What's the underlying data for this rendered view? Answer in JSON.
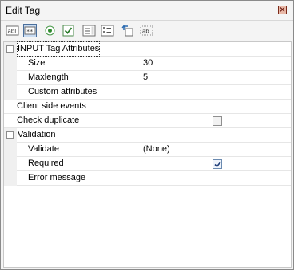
{
  "window": {
    "title": "Edit Tag",
    "close_icon": "close-icon"
  },
  "toolbar": {
    "buttons": [
      {
        "icon": "text-field-icon",
        "text": "abl",
        "active": false
      },
      {
        "icon": "password-field-icon",
        "text": "**",
        "active": true
      },
      {
        "icon": "radio-button-icon",
        "active": false
      },
      {
        "icon": "checkbox-icon",
        "active": false
      },
      {
        "icon": "listbox-icon",
        "active": false
      },
      {
        "icon": "listbox-multi-icon",
        "active": false
      },
      {
        "icon": "upload-icon",
        "active": false
      },
      {
        "icon": "label-icon",
        "text": "ab",
        "active": false
      }
    ]
  },
  "properties": {
    "input_tag_attributes": {
      "label": "INPUT Tag Attributes",
      "size": {
        "label": "Size",
        "value": "30"
      },
      "maxlength": {
        "label": "Maxlength",
        "value": "5"
      },
      "custom_attributes": {
        "label": "Custom attributes",
        "value": ""
      }
    },
    "client_side_events": {
      "label": "Client side events",
      "value": ""
    },
    "check_duplicate": {
      "label": "Check duplicate",
      "checked": false
    },
    "validation": {
      "label": "Validation",
      "validate": {
        "label": "Validate",
        "value": "(None)"
      },
      "required": {
        "label": "Required",
        "checked": true
      },
      "error_message": {
        "label": "Error message",
        "value": ""
      }
    }
  }
}
